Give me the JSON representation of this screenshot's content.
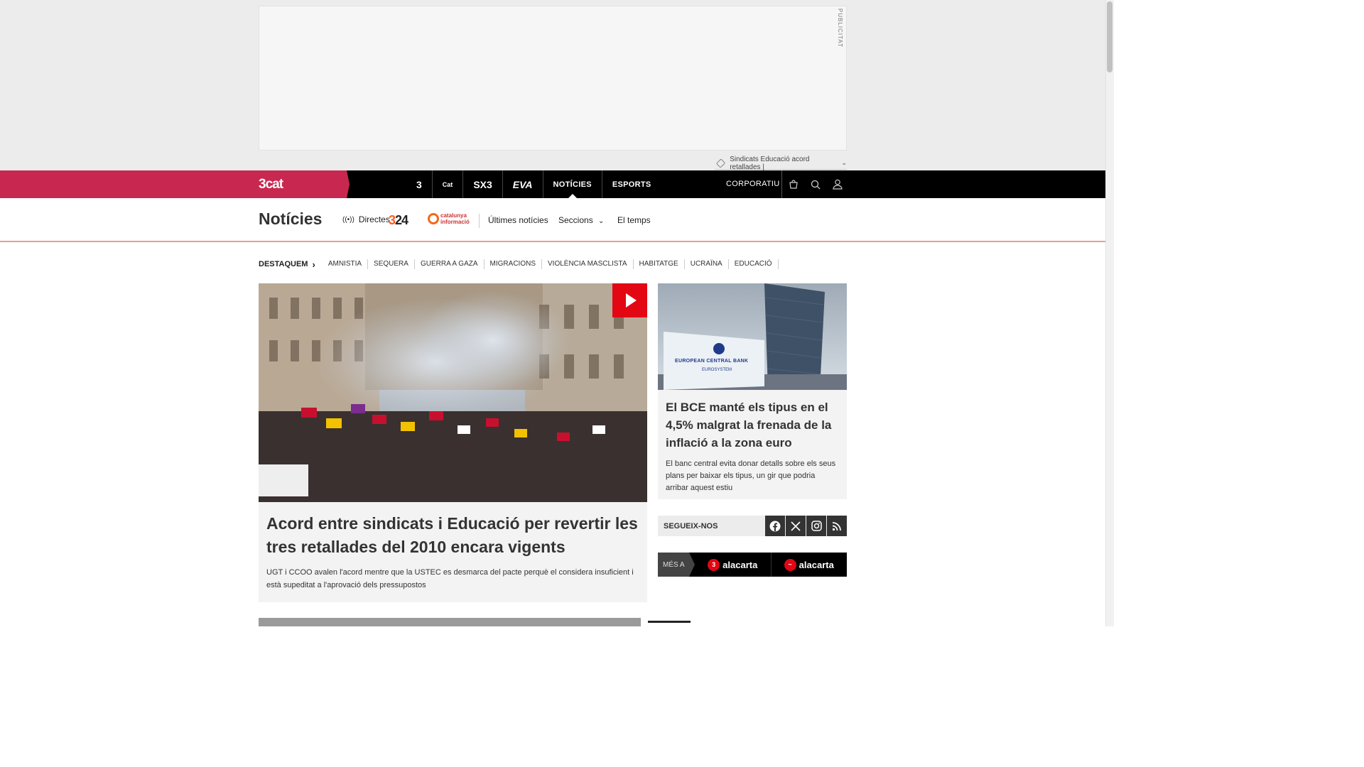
{
  "ad": {
    "label": "PUBLICITAT"
  },
  "topic_selector": {
    "value": "Sindicats Educació acord retallades |"
  },
  "brand": {
    "logo": "3cat"
  },
  "channels": [
    {
      "label": "3"
    },
    {
      "label": "Cat"
    },
    {
      "label": "SX3"
    },
    {
      "label": "EVA"
    },
    {
      "label": "NOTÍCIES"
    },
    {
      "label": "ESPORTS"
    }
  ],
  "corporate": {
    "label": "CORPORATIU"
  },
  "section": {
    "title": "Notícies",
    "live_label": "Directes",
    "logo_324": "324",
    "logo_catinfo": "catalunya informació",
    "links": [
      "Últimes notícies",
      "Seccions",
      "El temps"
    ]
  },
  "highlights": {
    "lead": "DESTAQUEM",
    "tags": [
      "AMNISTIA",
      "SEQUERA",
      "GUERRA A GAZA",
      "MIGRACIONS",
      "VIOLÈNCIA MASCLISTA",
      "HABITATGE",
      "UCRAÏNA",
      "EDUCACIÓ"
    ]
  },
  "main_story": {
    "headline": "Acord entre sindicats i Educació per revertir les tres retallades del 2010 encara vigents",
    "summary": "UGT i CCOO avalen l'acord mentre que la USTEC es desmarca del pacte perquè el considera insuficient i està supeditat a l'aprovació dels pressupostos"
  },
  "side_story": {
    "headline": "El BCE manté els tipus en el 4,5% malgrat la frenada de la inflació a la zona euro",
    "summary": "El banc central evita donar detalls sobre els seus plans per baixar els tipus, un gir que podria arribar aquest estiu",
    "image_caption": "EUROPEAN CENTRAL BANK",
    "image_subcaption": "EUROSYSTEM"
  },
  "follow": {
    "label": "SEGUEIX-NOS"
  },
  "more": {
    "label": "MÉS A",
    "apps": [
      "alacarta",
      "alacarta"
    ]
  },
  "colors": {
    "brand": "#c8284f",
    "accent_red": "#e30613",
    "orange_324": "#ff5a1f"
  }
}
